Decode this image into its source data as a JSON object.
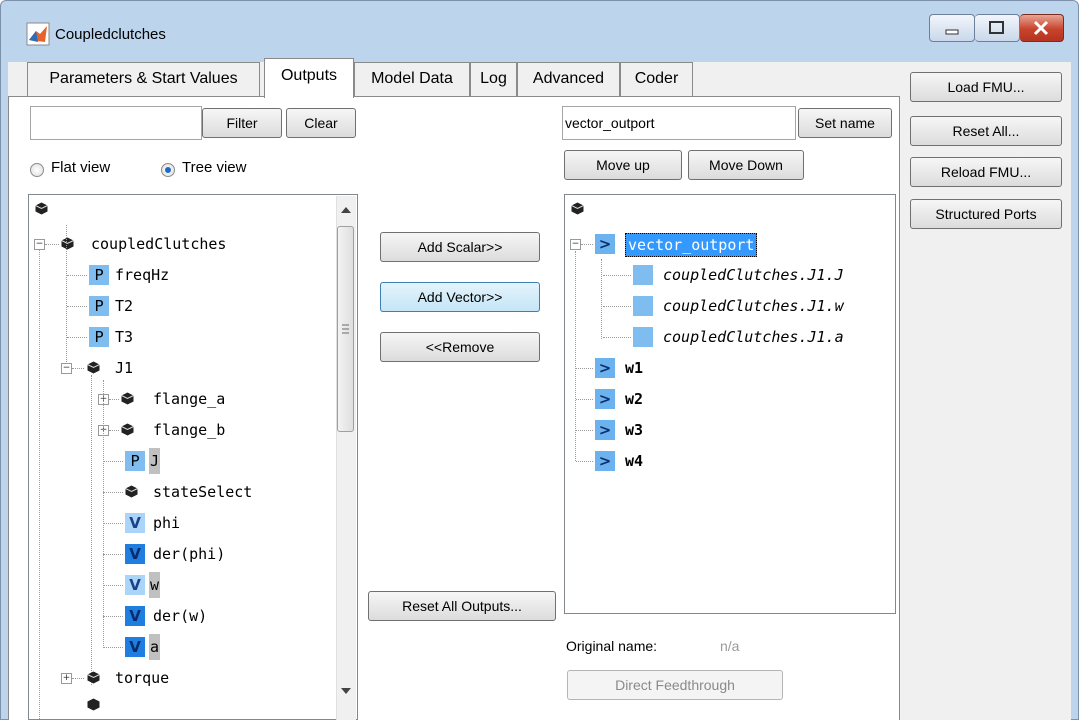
{
  "window": {
    "title": "Coupledclutches",
    "controls": {
      "minimize_icon": "minimize-icon",
      "maximize_icon": "maximize-icon",
      "close_icon": "close-icon"
    }
  },
  "tabs": [
    {
      "label": "Parameters & Start Values",
      "active": false
    },
    {
      "label": "Outputs",
      "active": true
    },
    {
      "label": "Model Data",
      "active": false
    },
    {
      "label": "Log",
      "active": false
    },
    {
      "label": "Advanced",
      "active": false
    },
    {
      "label": "Coder",
      "active": false
    }
  ],
  "filter": {
    "value": "",
    "filter_button": "Filter",
    "clear_button": "Clear"
  },
  "view_mode": {
    "flat_label": "Flat view",
    "tree_label": "Tree view",
    "selected": "Tree view"
  },
  "left_tree": {
    "rows": [
      {
        "name": "coupledClutches",
        "kind": "node"
      },
      {
        "name": "freqHz",
        "kind": "P"
      },
      {
        "name": "T2",
        "kind": "P"
      },
      {
        "name": "T3",
        "kind": "P"
      },
      {
        "name": "J1",
        "kind": "node"
      },
      {
        "name": "flange_a",
        "kind": "node"
      },
      {
        "name": "flange_b",
        "kind": "node"
      },
      {
        "name": "J",
        "kind": "P"
      },
      {
        "name": "stateSelect",
        "kind": "node"
      },
      {
        "name": "phi",
        "kind": "V"
      },
      {
        "name": "der(phi)",
        "kind": "V"
      },
      {
        "name": "w",
        "kind": "V"
      },
      {
        "name": "der(w)",
        "kind": "V"
      },
      {
        "name": "a",
        "kind": "V"
      },
      {
        "name": "torque",
        "kind": "node"
      }
    ],
    "badge_P": "P",
    "badge_V": "V"
  },
  "middle_buttons": {
    "add_scalar": "Add Scalar>>",
    "add_vector": "Add Vector>>",
    "remove": "<<Remove",
    "reset_all_outputs": "Reset All Outputs..."
  },
  "output_name": {
    "value": "vector_outport",
    "set_name_button": "Set name"
  },
  "move_buttons": {
    "move_up": "Move up",
    "move_down": "Move Down"
  },
  "right_tree": {
    "rows": [
      {
        "name": "vector_outport",
        "selected": true
      },
      {
        "name": "coupledClutches.J1.J"
      },
      {
        "name": "coupledClutches.J1.w"
      },
      {
        "name": "coupledClutches.J1.a"
      },
      {
        "name": "w1"
      },
      {
        "name": "w2"
      },
      {
        "name": "w3"
      },
      {
        "name": "w4"
      }
    ]
  },
  "original_name": {
    "label": "Original name:",
    "value": "n/a"
  },
  "direct_feedthrough": "Direct Feedthrough",
  "side_buttons": {
    "load_fmu": "Load FMU...",
    "reset_all": "Reset All...",
    "reload_fmu": "Reload FMU...",
    "structured_ports": "Structured Ports"
  },
  "colors": {
    "accent": "#3399ff",
    "selection": "#3399ff",
    "window_frame": "#bcd4ec"
  }
}
